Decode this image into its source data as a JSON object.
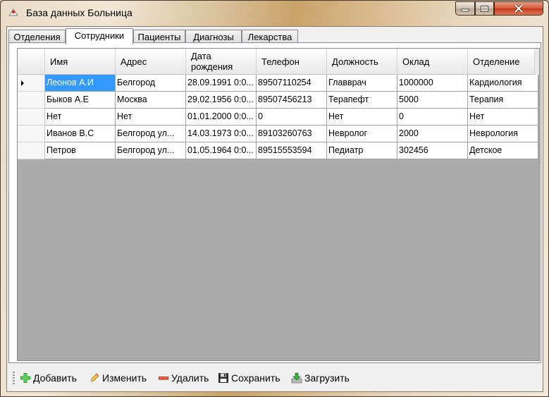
{
  "window": {
    "title": "База данных Больница",
    "app_icon": "hospital-icon"
  },
  "tabs": [
    {
      "label": "Отделения"
    },
    {
      "label": "Сотрудники"
    },
    {
      "label": "Пациенты"
    },
    {
      "label": "Диагнозы"
    },
    {
      "label": "Лекарства"
    }
  ],
  "grid": {
    "columns": [
      "Имя",
      "Адрес",
      "Дата\nрождения",
      "Телефон",
      "Должность",
      "Оклад",
      "Отделение"
    ],
    "rows": [
      [
        "Леонов А.И",
        "Белгород",
        "28.09.1991 0:0...",
        "89507110254",
        "Главврач",
        "1000000",
        "Кардиология"
      ],
      [
        "Быков А.Е",
        "Москва",
        "29.02.1956 0:0...",
        "89507456213",
        "Терапефт",
        "5000",
        "Терапия"
      ],
      [
        "Нет",
        "Нет",
        "01.01.2000 0:0...",
        "0",
        "Нет",
        "0",
        "Нет"
      ],
      [
        "Иванов В.С",
        "Белгород ул...",
        "14.03.1973 0:0...",
        "89103260763",
        "Невролог",
        "2000",
        "Неврология"
      ],
      [
        "Петров",
        "Белгород ул...",
        "01.05.1964 0:0...",
        "89515553594",
        "Педиатр",
        "302456",
        "Детское"
      ]
    ],
    "current_row_indicator": "row-pointer-icon"
  },
  "toolbar": {
    "add_label": "Добавить",
    "edit_label": "Изменить",
    "delete_label": "Удалить",
    "save_label": "Сохранить",
    "load_label": "Загрузить"
  },
  "colors": {
    "selection": "#3399ff",
    "grid_background": "#ababab",
    "close_button": "#c33a1a"
  }
}
